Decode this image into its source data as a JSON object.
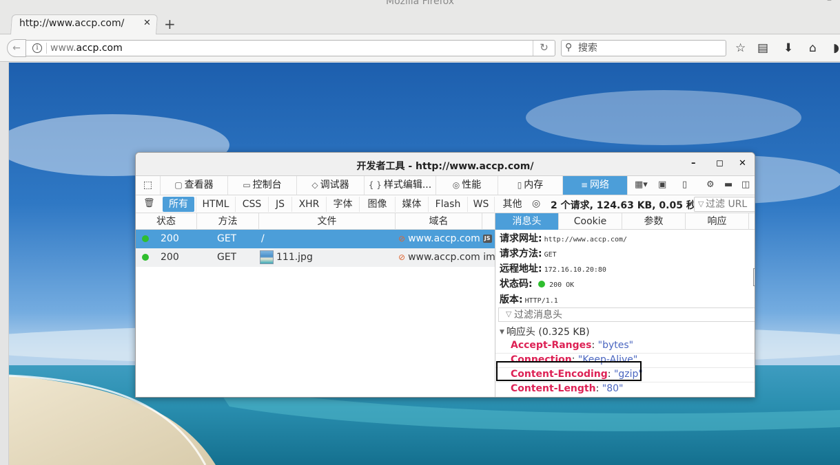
{
  "window": {
    "title": "Mozilla Firefox",
    "minimize_glyph": "–"
  },
  "tab": {
    "title": "http://www.accp.com/",
    "close_glyph": "✕",
    "new_tab_glyph": "+"
  },
  "navbar": {
    "url_prefix": "www.",
    "url_host": "accp.com",
    "search_placeholder": "搜索",
    "back_glyph": "←",
    "reload_glyph": "↻",
    "info_glyph": "i",
    "search_glyph": "⚲",
    "bookmark_glyph": "☆",
    "library_glyph": "▤",
    "downloads_glyph": "⬇",
    "home_glyph": "⌂",
    "pocket_glyph": "◗"
  },
  "devtools": {
    "title": "开发者工具 - http://www.accp.com/",
    "minimize_glyph": "–",
    "maximize_glyph": "◻",
    "close_glyph": "✕",
    "toolbar": {
      "pick_glyph": "⬚",
      "tools": [
        {
          "icon": "▢",
          "label": "查看器"
        },
        {
          "icon": "▭",
          "label": "控制台"
        },
        {
          "icon": "◇",
          "label": "调试器"
        },
        {
          "icon": "{ }",
          "label": "样式编辑..."
        },
        {
          "icon": "◎",
          "label": "性能"
        },
        {
          "icon": "▯",
          "label": "内存"
        },
        {
          "icon": "≡",
          "label": "网络"
        }
      ],
      "right_icons": [
        "▦▾",
        "▣",
        "▯",
        "⚙",
        "▬",
        "◫"
      ]
    },
    "filterbar": {
      "trash_glyph": "🗑",
      "filters": [
        "所有",
        "HTML",
        "CSS",
        "JS",
        "XHR",
        "字体",
        "图像",
        "媒体",
        "Flash",
        "WS",
        "其他"
      ],
      "perf_glyph": "◎",
      "summary": "2 个请求, 124.63 KB, 0.05 秒",
      "filter_url_placeholder": "过滤 URL",
      "filter_glyph": "▽"
    },
    "requests": {
      "columns": [
        "状态",
        "方法",
        "文件",
        "域名"
      ],
      "rows": [
        {
          "status": "200",
          "method": "GET",
          "file": "/",
          "domain": "www.accp.com",
          "type_badge": "JS"
        },
        {
          "status": "200",
          "method": "GET",
          "file": "111.jpg",
          "domain": "www.accp.com",
          "type_badge": "im"
        }
      ]
    },
    "details": {
      "tabs": [
        "消息头",
        "Cookie",
        "参数",
        "响应"
      ],
      "request_url_label": "请求网址:",
      "request_url": "http://www.accp.com/",
      "method_label": "请求方法:",
      "method": "GET",
      "remote_label": "远程地址:",
      "remote": "172.16.10.20:80",
      "status_label": "状态码:",
      "status": "200 OK",
      "version_label": "版本:",
      "version": "HTTP/1.1",
      "filter_headers_placeholder": "过滤消息头",
      "response_section": "响应头 (0.325 KB)",
      "headers": [
        {
          "name": "Accept-Ranges",
          "value": "\"bytes\""
        },
        {
          "name": "Connection",
          "value": "\"Keep-Alive\""
        },
        {
          "name": "Content-Encoding",
          "value": "\"gzip\""
        },
        {
          "name": "Content-Length",
          "value": "\"80\""
        }
      ]
    }
  },
  "colors": {
    "accent": "#4c9ed9",
    "status_ok": "#2fbe2f",
    "header_name": "#dd2255",
    "header_value": "#4a66c0"
  }
}
